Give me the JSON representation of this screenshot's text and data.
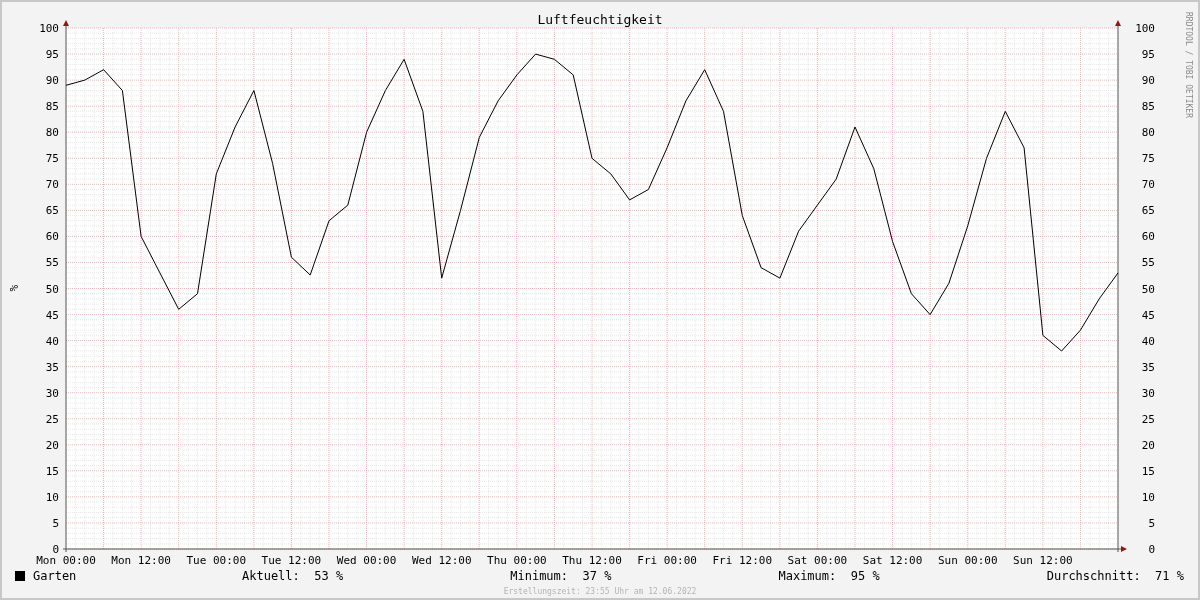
{
  "chart_data": {
    "type": "line",
    "title": "Luftfeuchtigkeit",
    "ylabel": "%",
    "categories": [
      "Mon 00:00",
      null,
      null,
      null,
      "Mon 12:00",
      null,
      null,
      null,
      "Tue 00:00",
      null,
      null,
      null,
      "Tue 12:00",
      null,
      null,
      null,
      "Wed 00:00",
      null,
      null,
      null,
      "Wed 12:00",
      null,
      null,
      null,
      "Thu 00:00",
      null,
      null,
      null,
      "Thu 12:00",
      null,
      null,
      null,
      "Fri 00:00",
      null,
      null,
      null,
      "Fri 12:00",
      null,
      null,
      null,
      "Sat 00:00",
      null,
      null,
      null,
      "Sat 12:00",
      null,
      null,
      null,
      "Sun 00:00",
      null,
      null,
      null,
      "Sun 12:00",
      null,
      null,
      null,
      null
    ],
    "series": [
      {
        "name": "Garten",
        "color": "#000000",
        "values": [
          89,
          90,
          92,
          88,
          60,
          53,
          46,
          49,
          72,
          81,
          88,
          74,
          56,
          52.6,
          63,
          66,
          80,
          88,
          94,
          84,
          52,
          65,
          79,
          86,
          91,
          95,
          94,
          91,
          75,
          72,
          67,
          69,
          77,
          86,
          92,
          84,
          64,
          54,
          52,
          61,
          66,
          71,
          81,
          73,
          59,
          49,
          45,
          51,
          62,
          75,
          84,
          77,
          41,
          38,
          42,
          48,
          53
        ]
      }
    ],
    "ylim": [
      0,
      100
    ],
    "grid": true,
    "yticks": [
      0,
      5,
      10,
      15,
      20,
      25,
      30,
      35,
      40,
      45,
      50,
      55,
      60,
      65,
      70,
      75,
      80,
      85,
      90,
      95,
      100
    ]
  },
  "right_axis": {
    "labels": [
      "100",
      "95",
      "90",
      "85",
      "80",
      "75",
      "70",
      "65",
      "60",
      "55",
      "50",
      "45",
      "40",
      "35",
      "30",
      "25",
      "20",
      "15",
      "10",
      "5",
      "0"
    ]
  },
  "credit": "RRDTOOL / TOBI OETIKER",
  "legend": {
    "stats": [
      {
        "label": "Aktuell:",
        "value": "53 %"
      },
      {
        "label": "Minimum:",
        "value": "37 %"
      },
      {
        "label": "Maximum:",
        "value": "95 %"
      },
      {
        "label": "Durchschnitt:",
        "value": "71 %"
      }
    ]
  },
  "footer": "Erstellungszeit: 23:55 Uhr am 12.06.2022"
}
